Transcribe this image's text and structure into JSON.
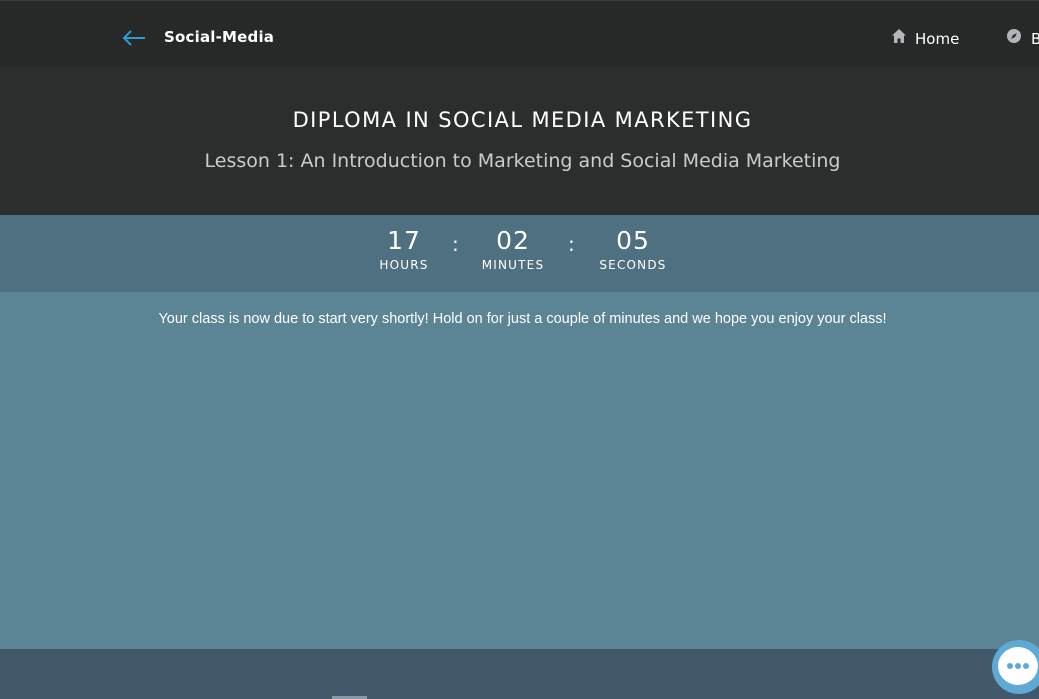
{
  "topbar": {
    "brand": "Social-Media",
    "nav": [
      {
        "label": "Home",
        "icon": "home-icon"
      },
      {
        "label": "B",
        "icon": "compass-icon"
      }
    ]
  },
  "header": {
    "course_title": "DIPLOMA IN SOCIAL MEDIA MARKETING",
    "lesson_title": "Lesson 1: An Introduction to Marketing and Social Media Marketing"
  },
  "countdown": {
    "separator": ":",
    "hours": {
      "value": "17",
      "label": "HOURS"
    },
    "minutes": {
      "value": "02",
      "label": "MINUTES"
    },
    "seconds": {
      "value": "05",
      "label": "SECONDS"
    }
  },
  "main": {
    "notice": "Your class is now due to start very shortly! Hold on for just a couple of minutes and we hope you enjoy your class!"
  },
  "colors": {
    "accent": "#2e9bd6",
    "countdown_bg": "#4f7080",
    "main_bg": "#5b8495",
    "footer_bg": "#41596a",
    "chat_bubble": "#5faad4"
  }
}
